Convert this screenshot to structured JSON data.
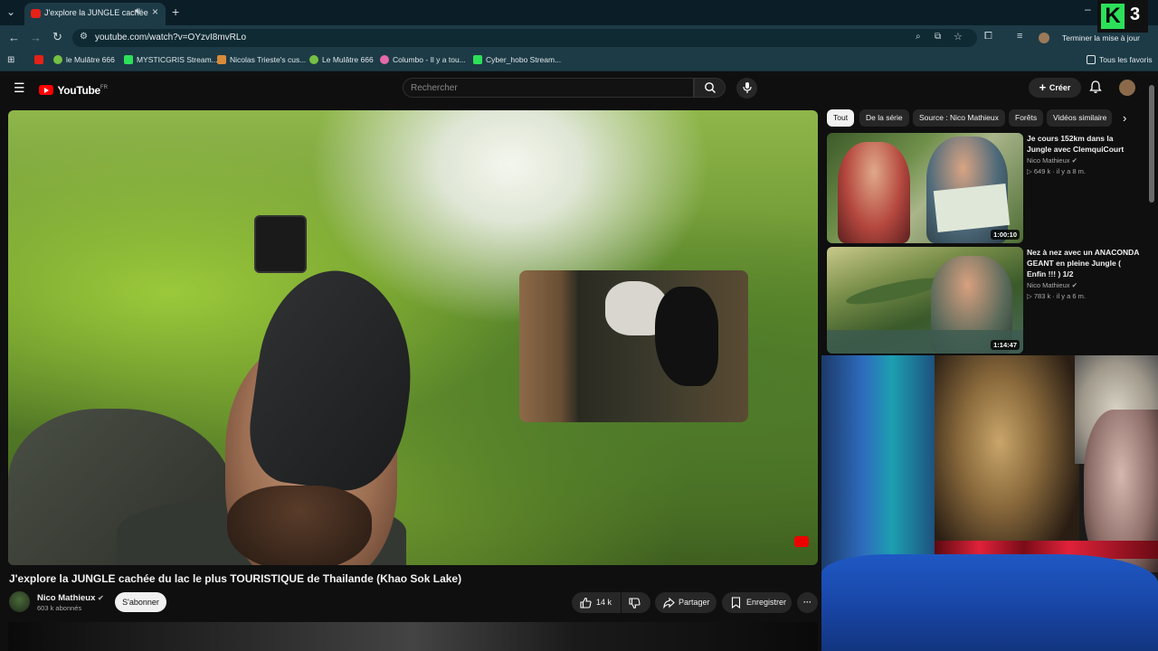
{
  "browser": {
    "tab_title": "J'explore la JUNGLE cachée",
    "url": "youtube.com/watch?v=OYzvI8mvRLo",
    "update_button": "Terminer la mise à jour",
    "bookmarks": [
      {
        "label": "le Mulâtre 666",
        "icon": "youtube",
        "color": "#e62117"
      },
      {
        "label": "MYSTICGRIS Stream...",
        "icon": "kick",
        "color": "#2de05a"
      },
      {
        "label": "Nicolas Trieste's cus...",
        "icon": "fox",
        "color": "#d98a3a"
      },
      {
        "label": "Le Mulâtre 666",
        "icon": "rumble",
        "color": "#75c043"
      },
      {
        "label": "Columbo - Il y a tou...",
        "icon": "pinwheel",
        "color": "#e46aa8"
      },
      {
        "label": "Cyber_hobo Stream...",
        "icon": "kick",
        "color": "#2de05a"
      }
    ],
    "all_bookmarks": "Tous les favoris"
  },
  "logo_overlay": {
    "letter": "K",
    "number": "3"
  },
  "youtube": {
    "logo_text": "YouTube",
    "region": "FR",
    "search_placeholder": "Rechercher",
    "create_label": "Créer"
  },
  "video": {
    "title": "J'explore la JUNGLE cachée du lac le plus TOURISTIQUE de Thailande (Khao Sok Lake)",
    "channel": "Nico Mathieux",
    "subscribers": "603 k abonnés",
    "subscribe_label": "S'abonner",
    "likes": "14 k",
    "share_label": "Partager",
    "save_label": "Enregistrer"
  },
  "chips": [
    "Tout",
    "De la série",
    "Source : Nico Mathieux",
    "Forêts",
    "Vidéos similaire"
  ],
  "recommendations": [
    {
      "title": "Je cours 152km dans la Jungle avec ClemquiCourt",
      "channel": "Nico Mathieux",
      "meta": "649 k · il y a 8 m.",
      "duration": "1:00:10"
    },
    {
      "title": "Nez à nez avec un ANACONDA GEANT en pleine Jungle ( Enfin !!! ) 1/2",
      "channel": "Nico Mathieux",
      "meta": "783 k · il y a 6 m.",
      "duration": "1:14:47"
    }
  ]
}
